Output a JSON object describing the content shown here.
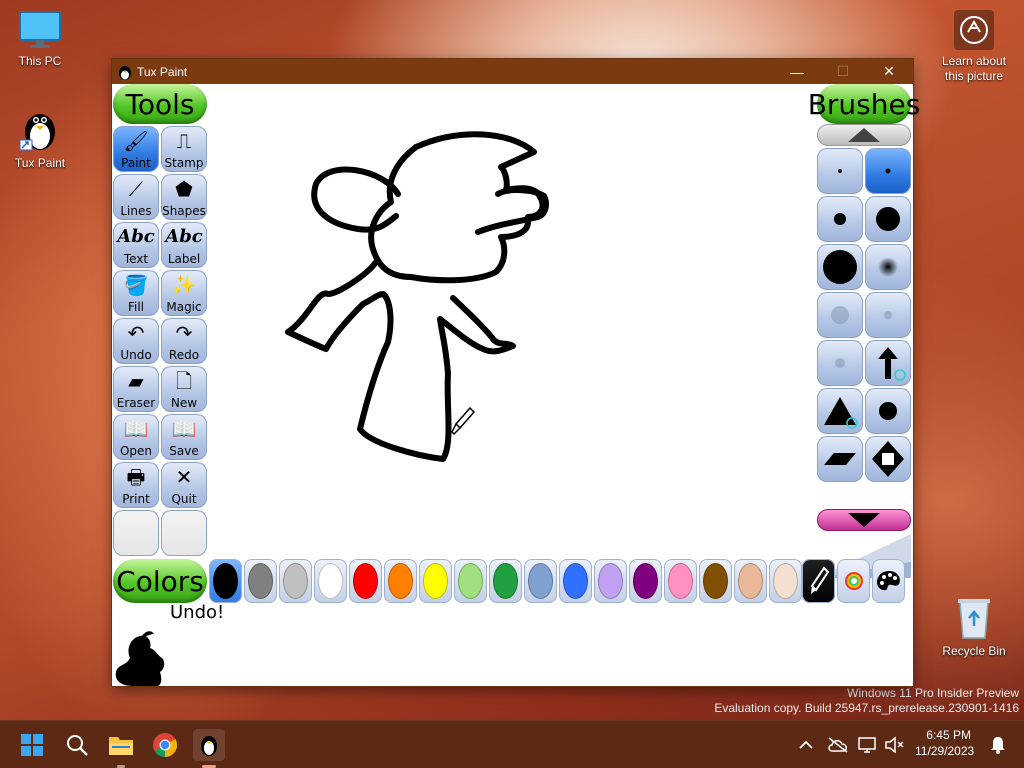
{
  "desktop": {
    "this_pc": "This PC",
    "tux_paint": "Tux Paint",
    "learn_about": "Learn about this picture",
    "recycle_bin": "Recycle Bin"
  },
  "window": {
    "title": "Tux Paint",
    "minimize_glyph": "—",
    "maximize_glyph": "☐",
    "close_glyph": "✕"
  },
  "tools_header": "Tools",
  "brushes_header": "Brushes",
  "colors_header": "Colors",
  "tools": [
    {
      "label": "Paint",
      "glyph": "🖌"
    },
    {
      "label": "Stamp",
      "glyph": "⎍"
    },
    {
      "label": "Lines",
      "glyph": "⟋"
    },
    {
      "label": "Shapes",
      "glyph": "⬟"
    },
    {
      "label": "Text",
      "glyph": "Abc"
    },
    {
      "label": "Label",
      "glyph": "Abc"
    },
    {
      "label": "Fill",
      "glyph": "🪣"
    },
    {
      "label": "Magic",
      "glyph": "✨"
    },
    {
      "label": "Undo",
      "glyph": "↶"
    },
    {
      "label": "Redo",
      "glyph": "↷"
    },
    {
      "label": "Eraser",
      "glyph": "▰"
    },
    {
      "label": "New",
      "glyph": "🗋"
    },
    {
      "label": "Open",
      "glyph": "📖"
    },
    {
      "label": "Save",
      "glyph": "📖"
    },
    {
      "label": "Print",
      "glyph": "🖶"
    },
    {
      "label": "Quit",
      "glyph": "✕"
    }
  ],
  "status_text": "Undo!",
  "colors": {
    "swatches": [
      "#000000",
      "#808080",
      "#c0c0c0",
      "#ffffff",
      "#ff0000",
      "#ff8000",
      "#ffff00",
      "#a0e080",
      "#20a040",
      "#80a0d0",
      "#3070ff",
      "#c0a0f0",
      "#800080",
      "#ff90c0",
      "#805000",
      "#e8b898",
      "#f4e0d0"
    ],
    "selected": "#000000"
  },
  "taskbar": {
    "time": "6:45 PM",
    "date": "11/29/2023"
  },
  "watermark": {
    "line1": "Windows 11 Pro Insider Preview",
    "line2": "Evaluation copy. Build 25947.rs_prerelease.230901-1416"
  }
}
